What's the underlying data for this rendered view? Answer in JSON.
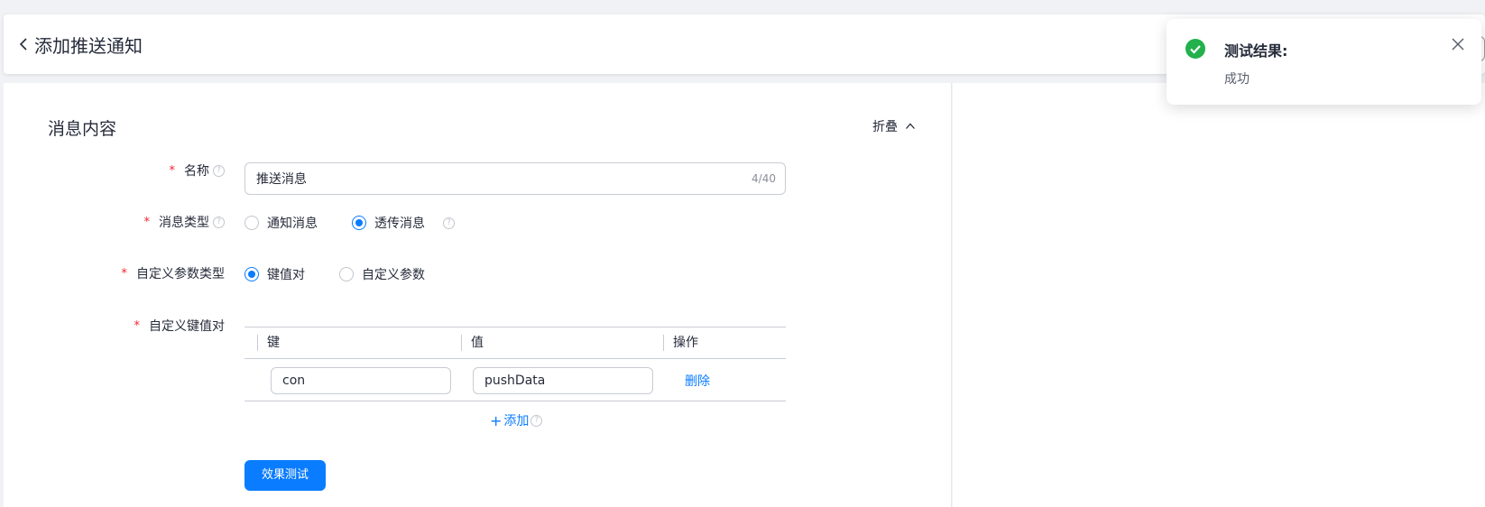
{
  "header": {
    "title": "添加推送通知"
  },
  "section": {
    "title": "消息内容",
    "collapse_label": "折叠"
  },
  "form": {
    "name": {
      "label": "名称",
      "value": "推送消息",
      "count": "4/40"
    },
    "msg_type": {
      "label": "消息类型",
      "options": [
        "通知消息",
        "透传消息"
      ],
      "selected": "透传消息"
    },
    "param_type": {
      "label": "自定义参数类型",
      "options": [
        "键值对",
        "自定义参数"
      ],
      "selected": "键值对"
    },
    "kv": {
      "label": "自定义键值对",
      "columns": [
        "键",
        "值",
        "操作"
      ],
      "rows": [
        {
          "key": "con",
          "value": "pushData",
          "action": "删除"
        }
      ],
      "add_label": "添加"
    },
    "test_button": "效果测试"
  },
  "toast": {
    "title": "测试结果:",
    "message": "成功",
    "status_color": "#22b14c"
  },
  "colors": {
    "primary": "#0a7cff",
    "required": "#f5222d"
  }
}
